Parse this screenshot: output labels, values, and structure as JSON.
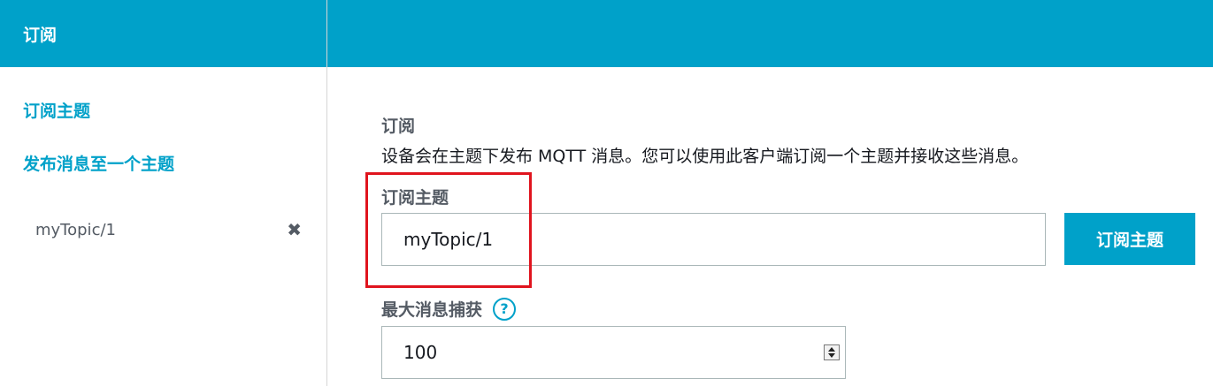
{
  "sidebar": {
    "header": "订阅",
    "links": [
      {
        "label": "订阅主题"
      },
      {
        "label": "发布消息至一个主题"
      }
    ],
    "topics": [
      {
        "label": "myTopic/1",
        "remove_icon": "close-icon"
      }
    ]
  },
  "main": {
    "section_title": "订阅",
    "section_desc": "设备会在主题下发布 MQTT 消息。您可以使用此客户端订阅一个主题并接收这些消息。",
    "topic_field": {
      "label": "订阅主题",
      "value": "myTopic/1",
      "button_label": "订阅主题"
    },
    "max_messages_field": {
      "label": "最大消息捕获",
      "help_icon": "?",
      "value": "100"
    }
  },
  "colors": {
    "accent": "#00a1c9",
    "highlight": "#e0141e"
  }
}
